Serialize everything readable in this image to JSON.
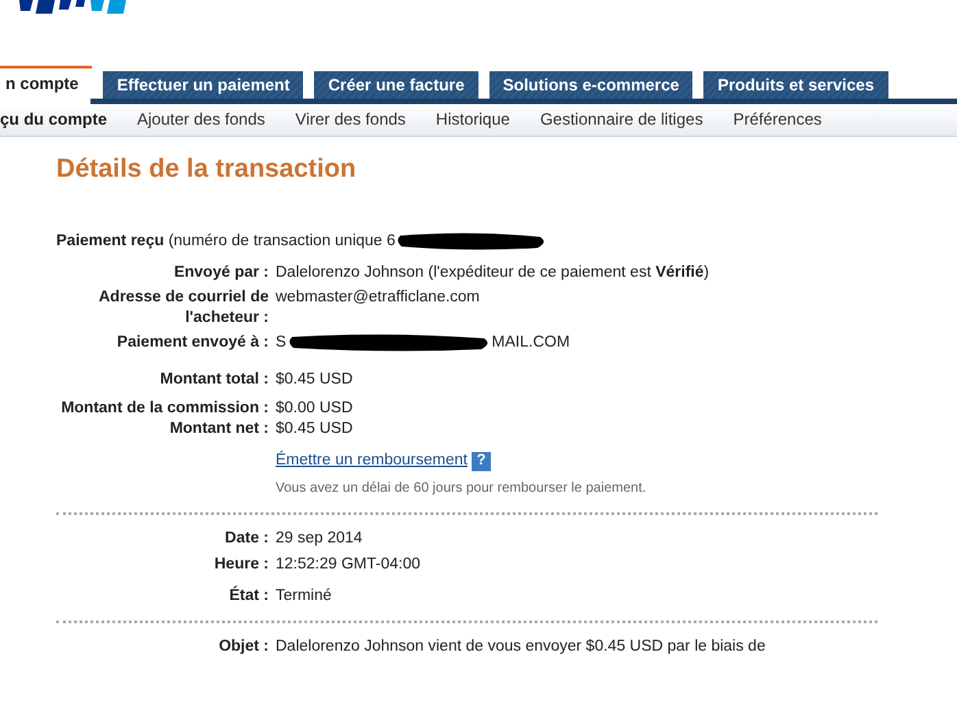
{
  "tabs": [
    {
      "label": "n compte",
      "selected": true
    },
    {
      "label": "Effectuer un paiement",
      "selected": false
    },
    {
      "label": "Créer une facture",
      "selected": false
    },
    {
      "label": "Solutions e-commerce",
      "selected": false
    },
    {
      "label": "Produits et services",
      "selected": false
    }
  ],
  "subnav": [
    {
      "label": "çu du compte",
      "selected": true
    },
    {
      "label": "Ajouter des fonds",
      "selected": false
    },
    {
      "label": "Virer des fonds",
      "selected": false
    },
    {
      "label": "Historique",
      "selected": false
    },
    {
      "label": "Gestionnaire de litiges",
      "selected": false
    },
    {
      "label": "Préférences",
      "selected": false
    }
  ],
  "title": "Détails de la transaction",
  "payment_heading": {
    "label": "Paiement reçu",
    "text": "(numéro de transaction unique 6",
    "redacted": true
  },
  "details": [
    {
      "label": "Envoyé par :",
      "value": "Dalelorenzo Johnson (l'expéditeur de ce paiement est **Vérifié**)",
      "redacted_before": false
    },
    {
      "label": "Adresse de courriel de l'acheteur :",
      "value": "webmaster@etrafficlane.com",
      "redacted_before": false
    },
    {
      "label": "Paiement envoyé à :",
      "value": "S",
      "value_after": "MAIL.COM",
      "redacted_before": true
    }
  ],
  "amounts": [
    {
      "label": "Montant total :",
      "value": "$0.45 USD"
    },
    {
      "label": "Montant de la commission :",
      "value": "$0.00 USD"
    },
    {
      "label": "Montant net :",
      "value": "$0.45 USD"
    }
  ],
  "refund_link": "Émettre un remboursement",
  "help_icon": "?",
  "refund_note": "Vous avez un délai de 60 jours pour rembourser le paiement.",
  "status": [
    {
      "label": "Date :",
      "value": "29 sep 2014"
    },
    {
      "label": "Heure :",
      "value": "12:52:29 GMT-04:00"
    },
    {
      "label": "État :",
      "value": "Terminé"
    }
  ],
  "object": {
    "label": "Objet :",
    "value": "Dalelorenzo Johnson vient de vous envoyer $0.45 USD par le biais de"
  }
}
